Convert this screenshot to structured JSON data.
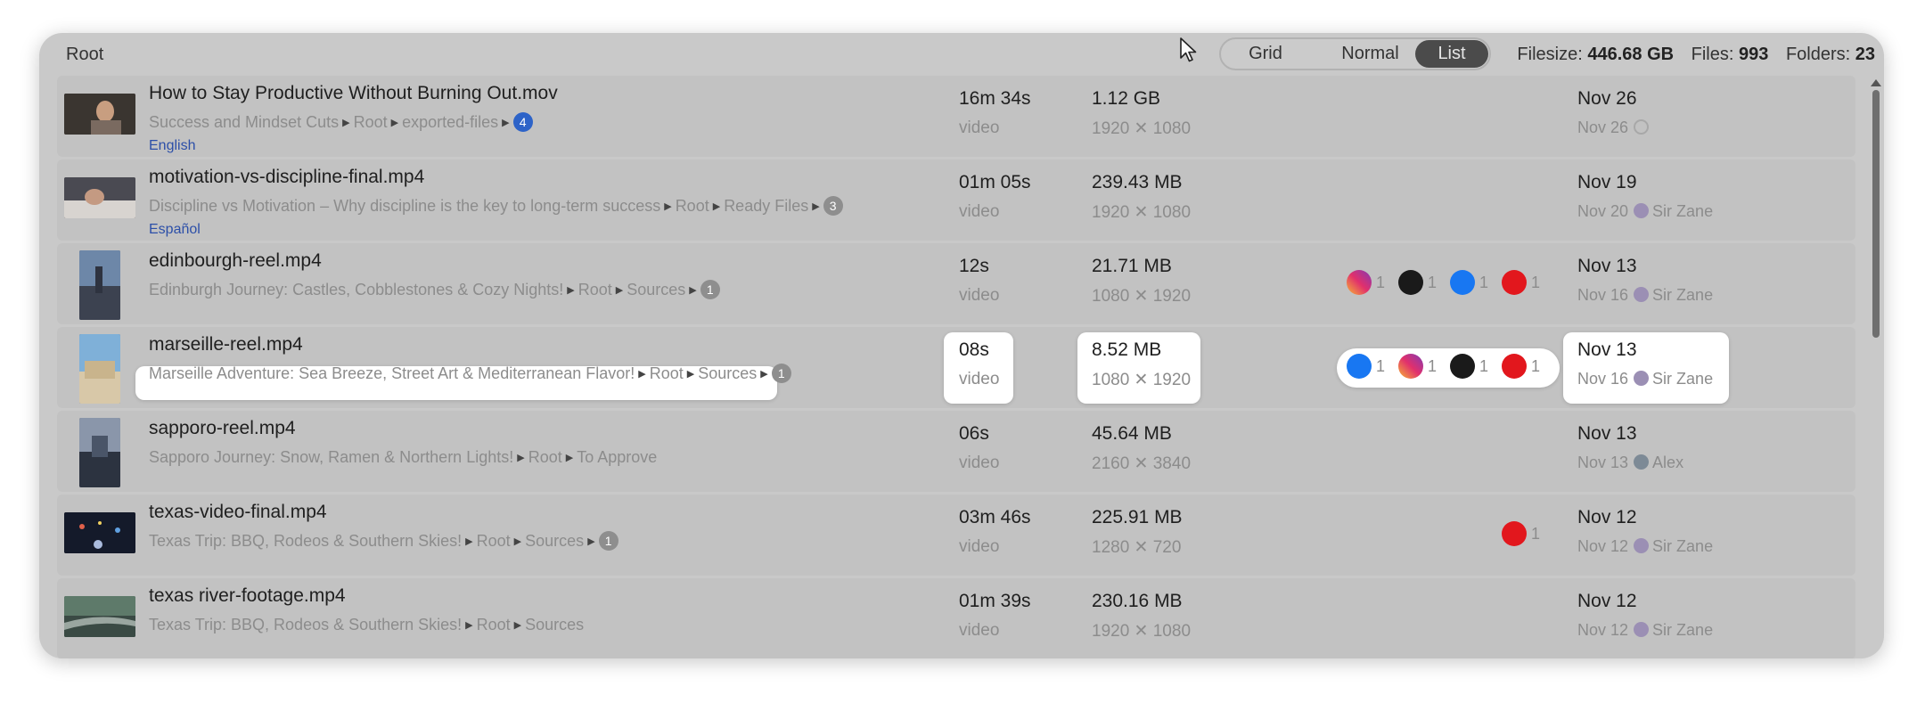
{
  "breadcrumb": "Root",
  "view_toggle": {
    "options": [
      "Grid",
      "Normal",
      "List"
    ],
    "active": "List"
  },
  "stats": {
    "filesize_label": "Filesize:",
    "filesize_value": "446.68 GB",
    "files_label": "Files:",
    "files_value": "993",
    "folders_label": "Folders:",
    "folders_value": "23"
  },
  "rows": [
    {
      "name": "How to Stay Productive Without Burning Out.mov",
      "project": "Success and Mindset Cuts",
      "path": [
        "Root",
        "exported-files"
      ],
      "badge": "4",
      "language": "English",
      "duration": "16m 34s",
      "type": "video",
      "size": "1.12 GB",
      "resolution": "1920 ✕ 1080",
      "date": "Nov 26",
      "sub_date": "Nov 26",
      "user": ""
    },
    {
      "name": "motivation-vs-discipline-final.mp4",
      "project": "Discipline vs Motivation – Why discipline is the key to long-term success",
      "path": [
        "Root",
        "Ready Files"
      ],
      "badge": "3",
      "language": "Español",
      "duration": "01m 05s",
      "type": "video",
      "size": "239.43 MB",
      "resolution": "1920 ✕ 1080",
      "date": "Nov 19",
      "sub_date": "Nov 20",
      "user": "Sir Zane"
    },
    {
      "name": "edinbourgh-reel.mp4",
      "project": "Edinburgh Journey: Castles, Cobblestones & Cozy Nights!",
      "path": [
        "Root",
        "Sources"
      ],
      "badge": "1",
      "duration": "12s",
      "type": "video",
      "size": "21.71 MB",
      "resolution": "1080 ✕ 1920",
      "date": "Nov 13",
      "sub_date": "Nov 16",
      "user": "Sir Zane",
      "socials": [
        {
          "icon": "instagram-icon",
          "count": "1"
        },
        {
          "icon": "tiktok-icon",
          "count": "1"
        },
        {
          "icon": "facebook-icon",
          "count": "1"
        },
        {
          "icon": "youtube-icon",
          "count": "1"
        }
      ]
    },
    {
      "name": "marseille-reel.mp4",
      "project": "Marseille Adventure: Sea Breeze, Street Art & Mediterranean Flavor!",
      "path": [
        "Root",
        "Sources"
      ],
      "badge": "1",
      "duration": "08s",
      "type": "video",
      "size": "8.52 MB",
      "resolution": "1080 ✕ 1920",
      "date": "Nov 13",
      "sub_date": "Nov 16",
      "user": "Sir Zane",
      "socials": [
        {
          "icon": "facebook-icon",
          "count": "1"
        },
        {
          "icon": "instagram-icon",
          "count": "1"
        },
        {
          "icon": "tiktok-icon",
          "count": "1"
        },
        {
          "icon": "youtube-icon",
          "count": "1"
        }
      ]
    },
    {
      "name": "sapporo-reel.mp4",
      "project": "Sapporo Journey: Snow, Ramen & Northern Lights!",
      "path": [
        "Root",
        "To Approve"
      ],
      "duration": "06s",
      "type": "video",
      "size": "45.64 MB",
      "resolution": "2160 ✕ 3840",
      "date": "Nov 13",
      "sub_date": "Nov 13",
      "user": "Alex"
    },
    {
      "name": "texas-video-final.mp4",
      "project": "Texas Trip: BBQ, Rodeos & Southern Skies!",
      "path": [
        "Root",
        "Sources"
      ],
      "badge": "1",
      "duration": "03m 46s",
      "type": "video",
      "size": "225.91 MB",
      "resolution": "1280 ✕ 720",
      "date": "Nov 12",
      "sub_date": "Nov 12",
      "user": "Sir Zane",
      "socials": [
        {
          "icon": "youtube-icon",
          "count": "1"
        }
      ]
    },
    {
      "name": "texas river-footage.mp4",
      "project": "Texas Trip: BBQ, Rodeos & Southern Skies!",
      "path": [
        "Root",
        "Sources"
      ],
      "duration": "01m 39s",
      "type": "video",
      "size": "230.16 MB",
      "resolution": "1920 ✕ 1080",
      "date": "Nov 12",
      "sub_date": "Nov 12",
      "user": "Sir Zane"
    }
  ],
  "colors": {
    "panel": "#c9c9c9",
    "row": "#c2c2c2",
    "badge_blue": "#2d63c8",
    "language": "#2c4fa8",
    "toggle_active": "#4b4b4b"
  }
}
